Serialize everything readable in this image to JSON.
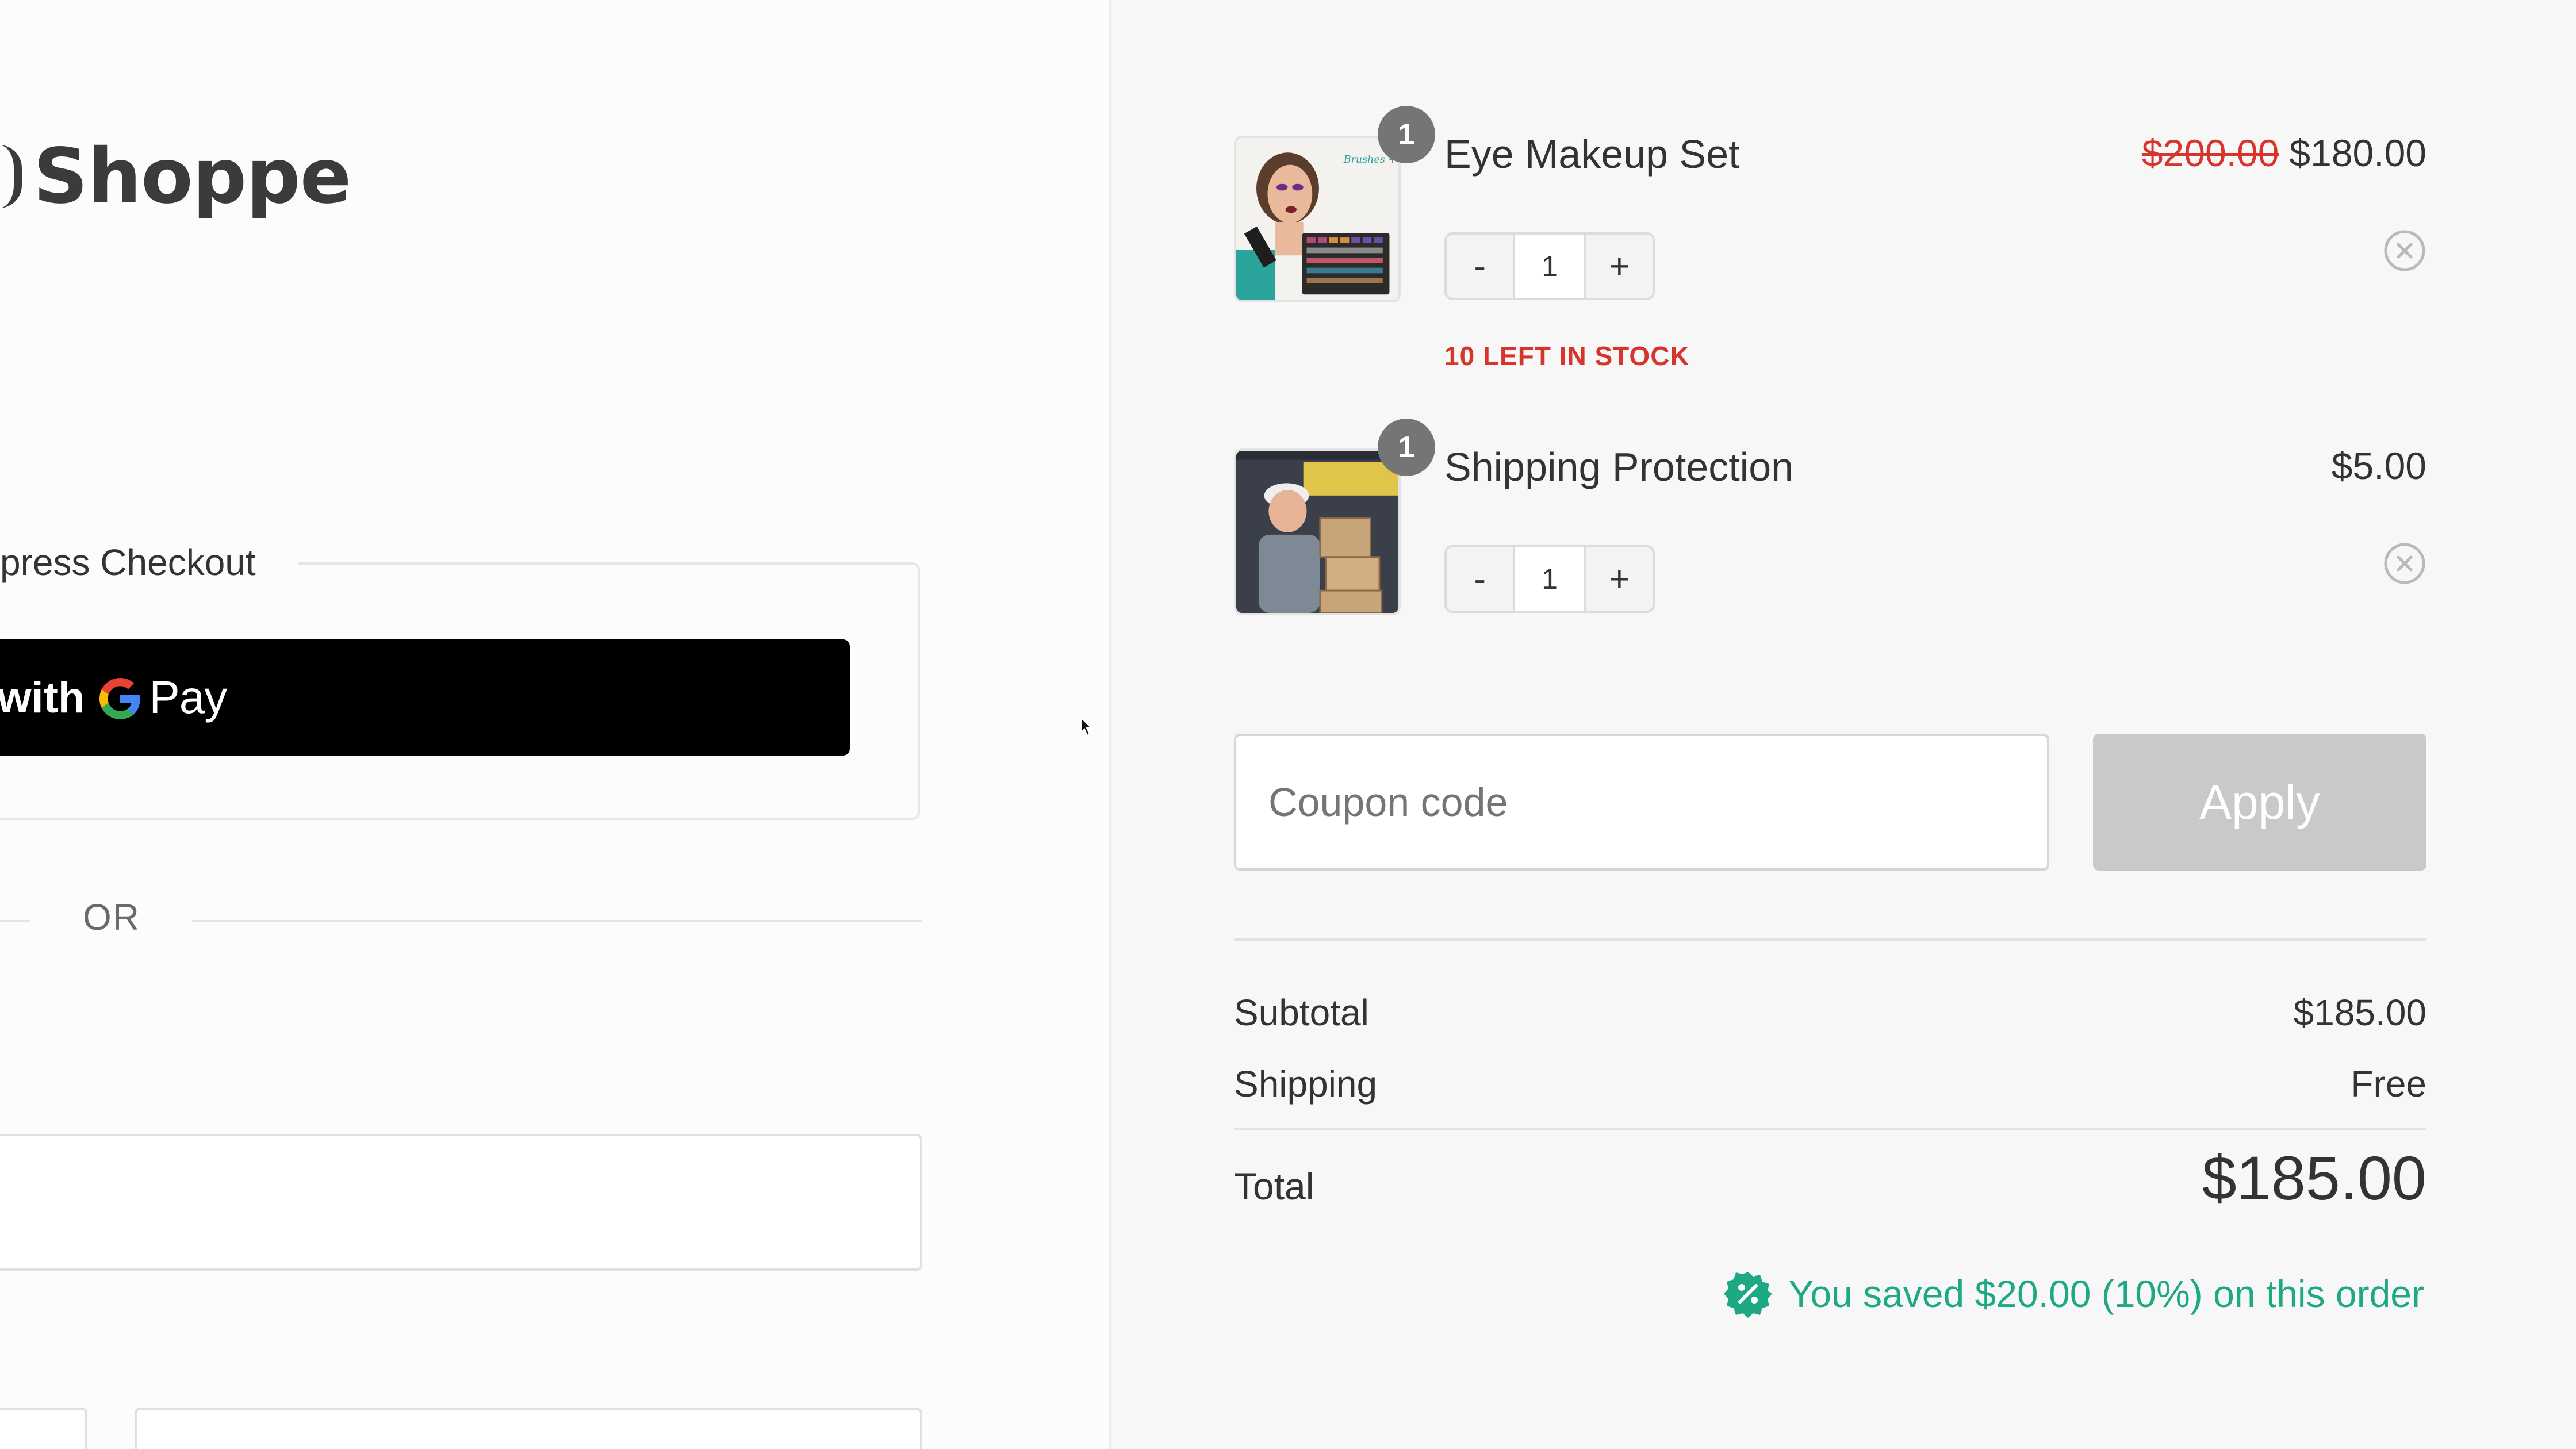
{
  "brand": {
    "name": "Shoppe"
  },
  "express": {
    "label": "press Checkout",
    "gpay_prefix": "y with",
    "gpay_suffix": "Pay",
    "or_label": "OR"
  },
  "cart": {
    "items": [
      {
        "quantity_badge": "1",
        "name": "Eye Makeup Set",
        "price_original": "$200.00",
        "price": "$180.00",
        "minus": "-",
        "qty": "1",
        "plus": "+",
        "stock_note": "10 LEFT IN STOCK",
        "thumb_text": "Brushes + Palette!"
      },
      {
        "quantity_badge": "1",
        "name": "Shipping Protection",
        "price": "$5.00",
        "minus": "-",
        "qty": "1",
        "plus": "+"
      }
    ]
  },
  "coupon": {
    "placeholder": "Coupon code",
    "apply_label": "Apply"
  },
  "summary": {
    "subtotal_label": "Subtotal",
    "subtotal_value": "$185.00",
    "shipping_label": "Shipping",
    "shipping_value": "Free",
    "total_label": "Total",
    "total_value": "$185.00",
    "savings_text": "You saved $20.00 (10%) on this order"
  },
  "colors": {
    "sale_red": "#d7352c",
    "savings_green": "#1fa884",
    "apply_disabled": "#c9c9c9",
    "gpay_black": "#000000"
  },
  "icons": [
    "cursor-icon",
    "google-g-icon",
    "remove-icon",
    "discount-badge-icon"
  ]
}
